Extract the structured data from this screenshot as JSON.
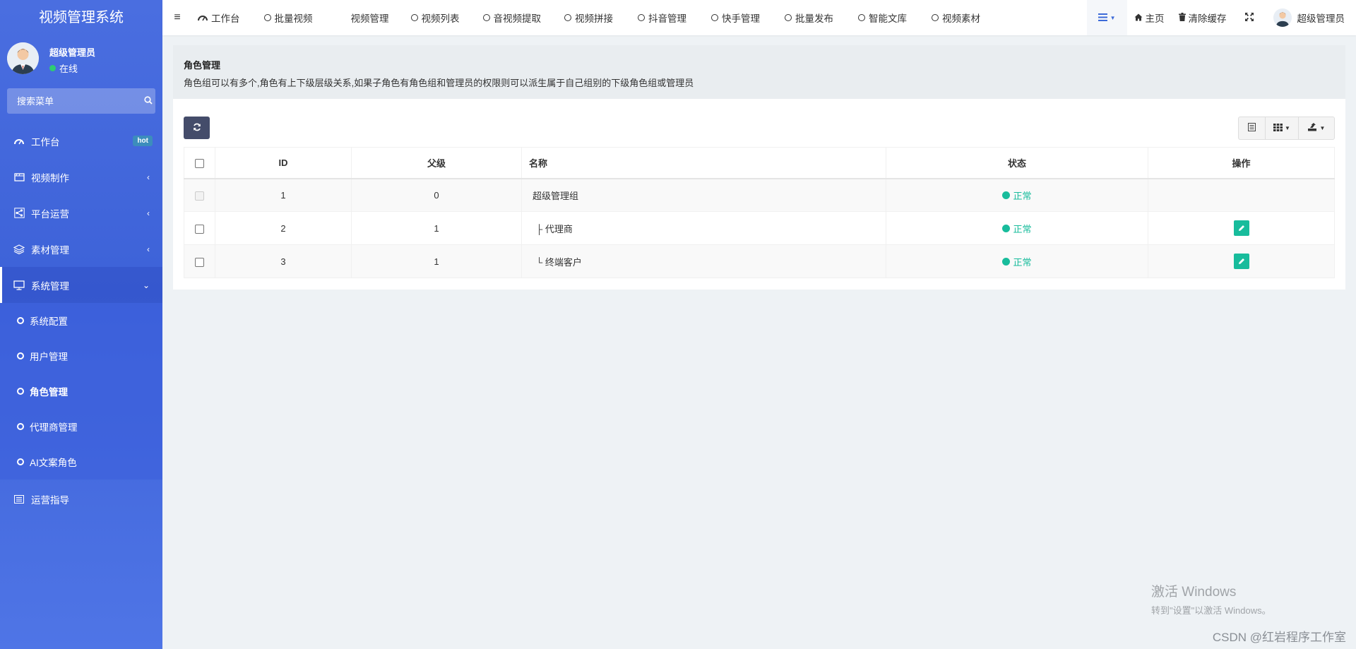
{
  "app": {
    "title": "视频管理系统"
  },
  "user": {
    "name": "超级管理员",
    "status": "在线"
  },
  "sidebar": {
    "search_placeholder": "搜索菜单",
    "items": [
      {
        "label": "工作台",
        "badge": "hot"
      },
      {
        "label": "视频制作"
      },
      {
        "label": "平台运营"
      },
      {
        "label": "素材管理"
      },
      {
        "label": "系统管理"
      },
      {
        "label": "运营指导"
      }
    ],
    "sub_items": [
      "系统配置",
      "用户管理",
      "角色管理",
      "代理商管理",
      "AI文案角色"
    ]
  },
  "topnav": {
    "items": [
      "工作台",
      "批量视频",
      "视频管理",
      "视频列表",
      "音视频提取",
      "视频拼接",
      "抖音管理",
      "快手管理",
      "批量发布",
      "智能文库",
      "视频素材"
    ],
    "home": "主页",
    "clear_cache": "清除缓存",
    "user": "超级管理员"
  },
  "page": {
    "title": "角色管理",
    "description": "角色组可以有多个,角色有上下级层级关系,如果子角色有角色组和管理员的权限则可以派生属于自己组别的下级角色组或管理员"
  },
  "table": {
    "headers": {
      "id": "ID",
      "parent": "父级",
      "name": "名称",
      "status": "状态",
      "action": "操作"
    },
    "rows": [
      {
        "id": "1",
        "parent": "0",
        "name": "超级管理组",
        "status": "正常"
      },
      {
        "id": "2",
        "parent": "1",
        "name": "├ 代理商",
        "status": "正常"
      },
      {
        "id": "3",
        "parent": "1",
        "name": "└ 终端客户",
        "status": "正常"
      }
    ]
  },
  "watermark": {
    "line1": "激活 Windows",
    "line2": "转到\"设置\"以激活 Windows。",
    "csdn": "CSDN @红岩程序工作室"
  },
  "colors": {
    "sidebar": "#4a6ee0",
    "status_green": "#18bc9c",
    "refresh_button": "#444c6a"
  }
}
